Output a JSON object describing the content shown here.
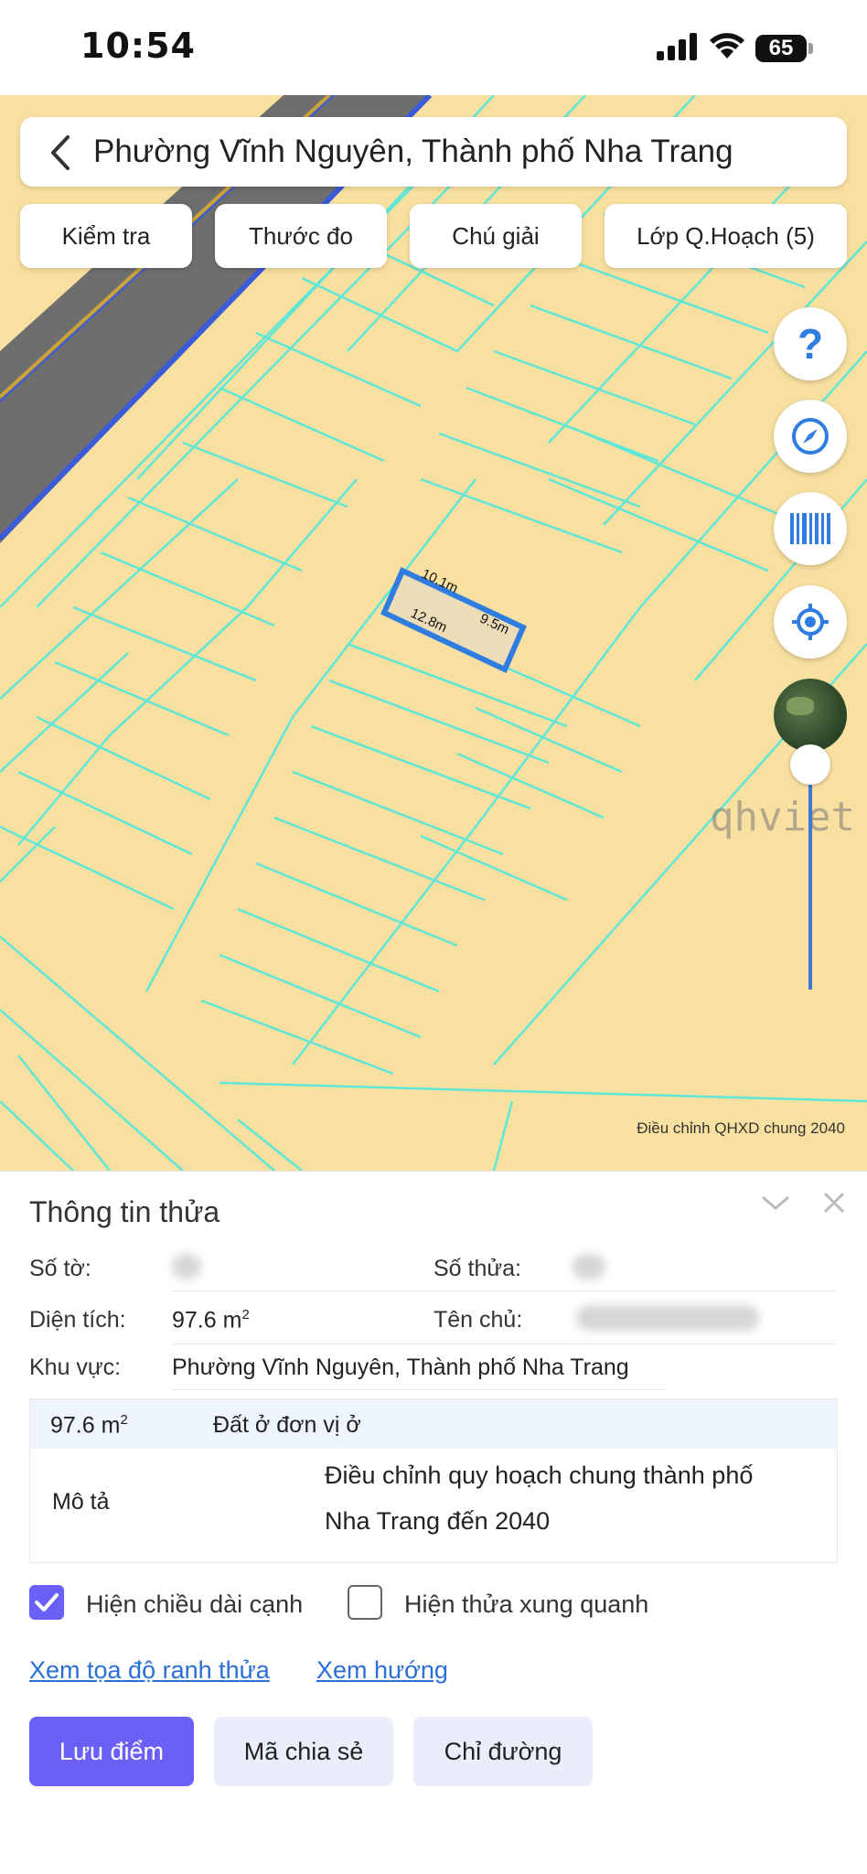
{
  "status": {
    "time": "10:54",
    "battery": "65"
  },
  "map": {
    "search_title": "Phường Vĩnh Nguyên, Thành phố Nha Trang",
    "chips": [
      "Kiểm tra",
      "Thước đo",
      "Chú giải",
      "Lớp Q.Hoạch (5)"
    ],
    "parcel_dims": [
      "10.1m",
      "9.5m",
      "12.8m"
    ],
    "watermark": "qhviet",
    "credit": "Điều chỉnh QHXD chung 2040",
    "fab_icons": [
      "help-icon",
      "compass-icon",
      "barcode-icon",
      "locate-icon",
      "satellite-layer-icon"
    ],
    "colors": {
      "land": "#f8e0a0",
      "lines": "#5fe6d6",
      "road": "#6e6e6e",
      "parcel": "#2f7de1"
    }
  },
  "panel": {
    "title": "Thông tin thửa",
    "so_to_label": "Số tờ:",
    "so_thua_label": "Số thửa:",
    "dien_tich_label": "Diện tích:",
    "dien_tich_value": "97.6 m",
    "area_unit_exp": "2",
    "ten_chu_label": "Tên chủ:",
    "khu_vuc_label": "Khu vực:",
    "khu_vuc_value": "Phường Vĩnh Nguyên, Thành phố Nha Trang",
    "table": {
      "area": "97.6 m",
      "land_type": "Đất ở đơn vị ở",
      "desc_label": "Mô tả",
      "desc_line1": "Điều chỉnh quy hoạch chung thành phố",
      "desc_line2": "Nha Trang đến 2040"
    },
    "checkbox_edge_label": "Hiện chiều dài cạnh",
    "checkbox_edge_checked": true,
    "checkbox_neighbors_label": "Hiện thửa xung quanh",
    "checkbox_neighbors_checked": false,
    "link_coords": "Xem tọa độ ranh thửa",
    "link_direction": "Xem hướng",
    "btn_save": "Lưu điểm",
    "btn_share": "Mã chia sẻ",
    "btn_route": "Chỉ đường",
    "accent": "#6a60f5"
  }
}
